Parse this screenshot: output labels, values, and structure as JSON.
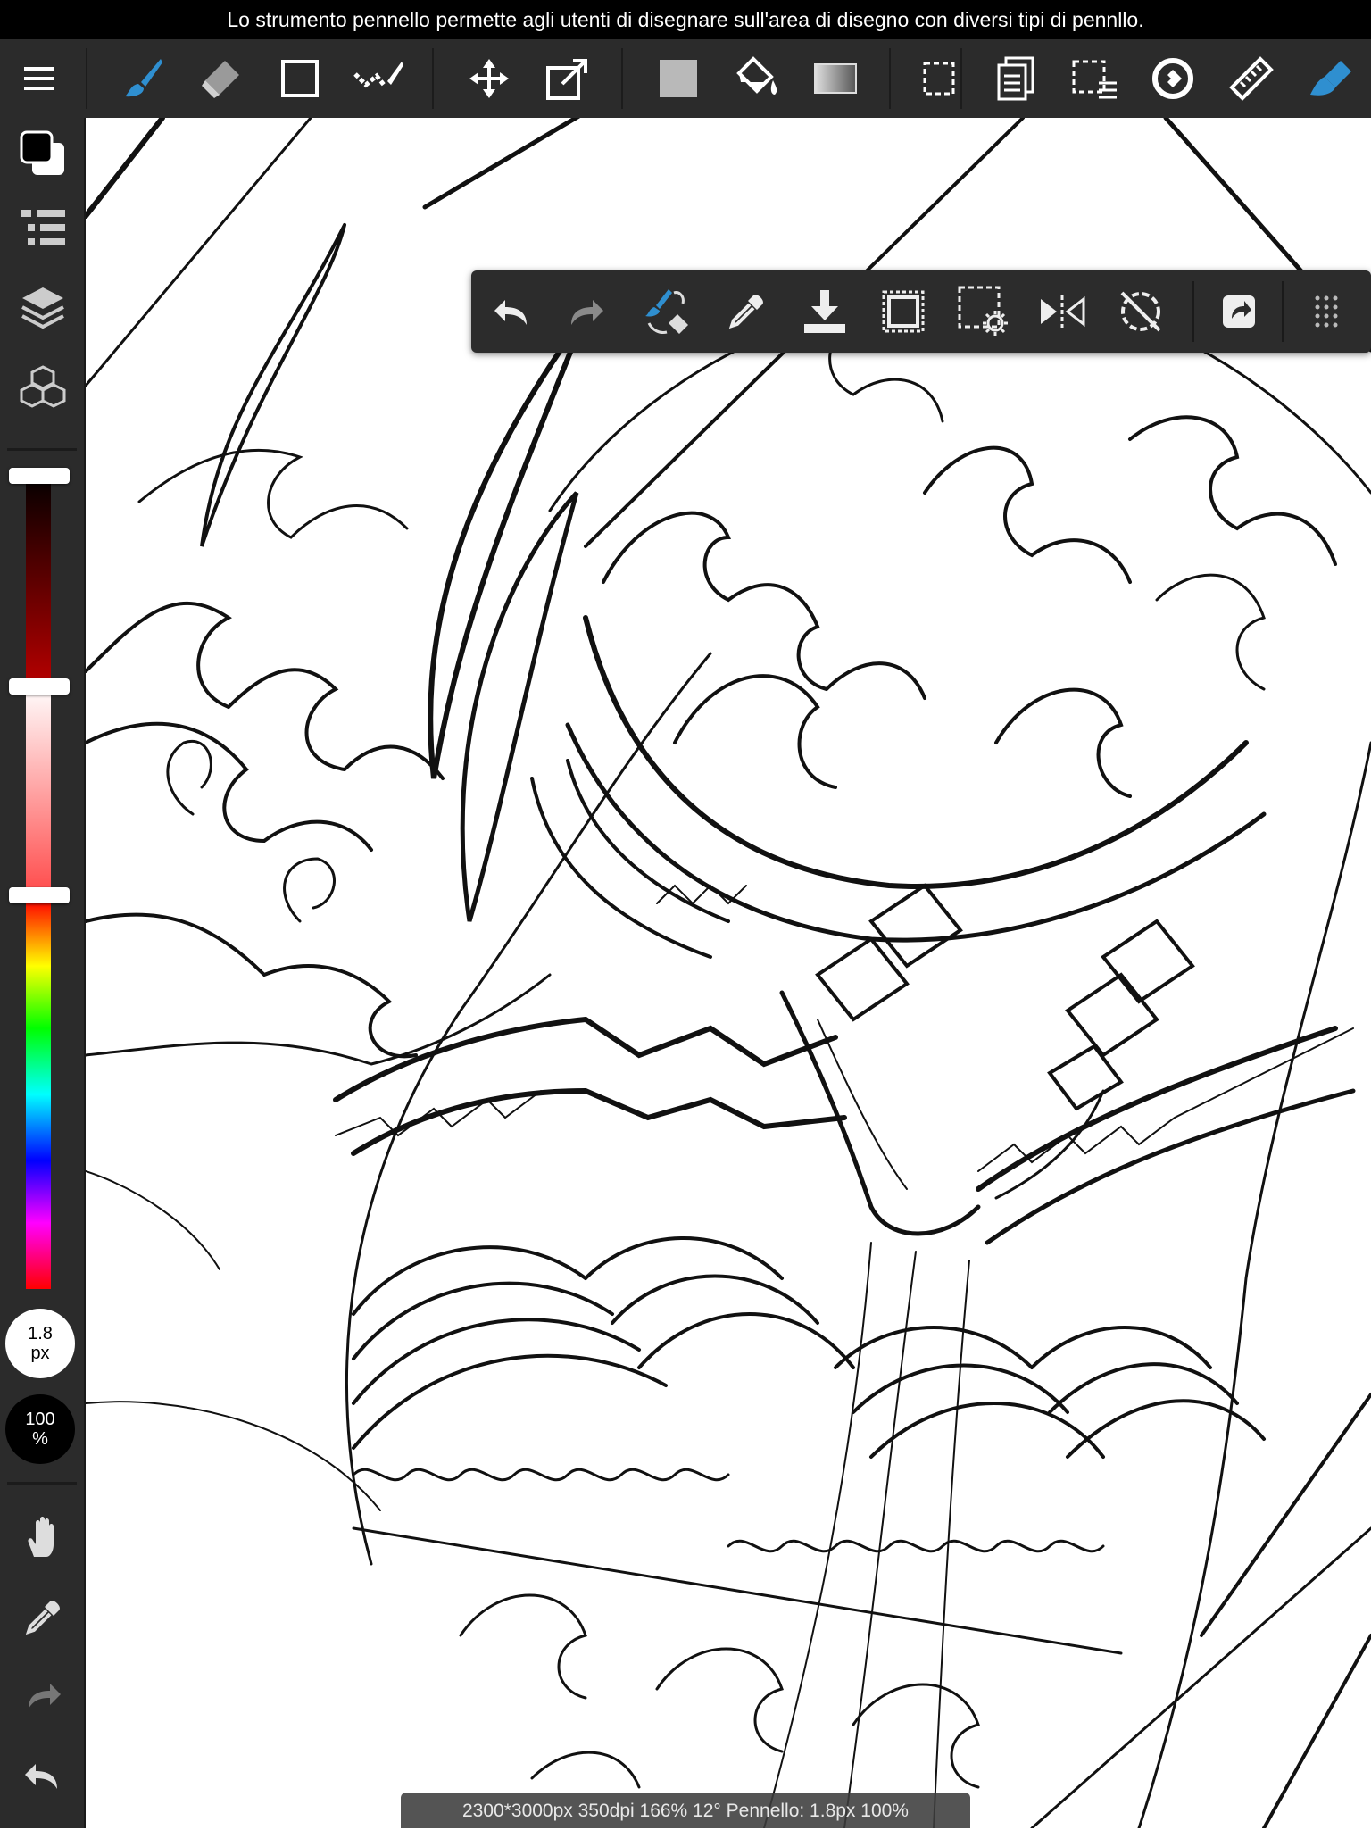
{
  "caption": "Lo strumento pennello permette agli utenti di disegnare sull'area di disegno con diversi tipi di pennllo.",
  "status_bar": "2300*3000px 350dpi 166% 12° Pennello: 1.8px 100%",
  "brush": {
    "size_value": "1.8",
    "size_unit": "px",
    "opacity_value": "100",
    "opacity_unit": "%"
  },
  "colors": {
    "accent": "#2f8fd0",
    "toolbar_bg": "#2b2b2b",
    "main": "#000000",
    "sub": "#ffffff"
  },
  "toolbar": {
    "tools": [
      "menu-icon",
      "brush-icon",
      "eraser-icon",
      "rectangle-icon",
      "smudge-icon",
      "move-icon",
      "transform-icon",
      "fill-color-icon",
      "bucket-icon",
      "gradient-icon",
      "select-icon",
      "copy-icon",
      "select-menu-icon",
      "snap-icon",
      "ruler-icon",
      "brush-settings-icon"
    ]
  },
  "float_bar": {
    "tools": [
      "undo-icon",
      "redo-icon",
      "brush-eraser-switch-icon",
      "eyedropper-icon",
      "save-icon",
      "frame-icon",
      "selection-settings-icon",
      "flip-icon",
      "rotation-reset-icon",
      "share-icon",
      "grip-icon"
    ]
  }
}
